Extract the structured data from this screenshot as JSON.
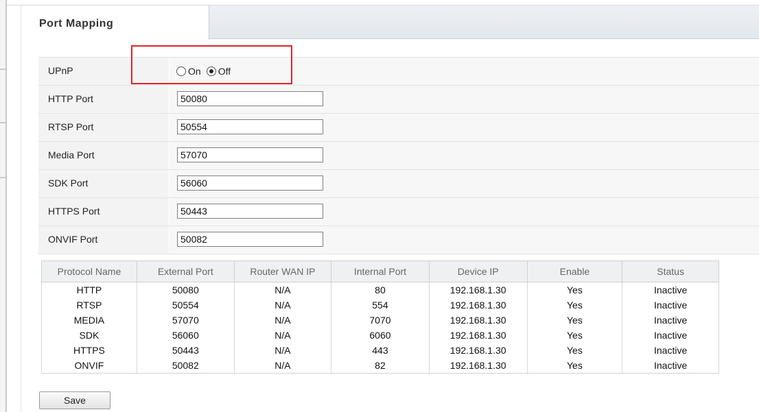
{
  "tab": {
    "title": "Port Mapping"
  },
  "upnp": {
    "label": "UPnP",
    "options": [
      {
        "label": "On",
        "checked": false
      },
      {
        "label": "Off",
        "checked": true
      }
    ]
  },
  "ports": [
    {
      "label": "HTTP Port",
      "value": "50080"
    },
    {
      "label": "RTSP Port",
      "value": "50554"
    },
    {
      "label": "Media Port",
      "value": "57070"
    },
    {
      "label": "SDK Port",
      "value": "56060"
    },
    {
      "label": "HTTPS Port",
      "value": "50443"
    },
    {
      "label": "ONVIF Port",
      "value": "50082"
    }
  ],
  "mapping_table": {
    "columns": [
      "Protocol Name",
      "External Port",
      "Router WAN IP",
      "Internal Port",
      "Device IP",
      "Enable",
      "Status"
    ],
    "rows": [
      [
        "HTTP",
        "50080",
        "N/A",
        "80",
        "192.168.1.30",
        "Yes",
        "Inactive"
      ],
      [
        "RTSP",
        "50554",
        "N/A",
        "554",
        "192.168.1.30",
        "Yes",
        "Inactive"
      ],
      [
        "MEDIA",
        "57070",
        "N/A",
        "7070",
        "192.168.1.30",
        "Yes",
        "Inactive"
      ],
      [
        "SDK",
        "56060",
        "N/A",
        "6060",
        "192.168.1.30",
        "Yes",
        "Inactive"
      ],
      [
        "HTTPS",
        "50443",
        "N/A",
        "443",
        "192.168.1.30",
        "Yes",
        "Inactive"
      ],
      [
        "ONVIF",
        "50082",
        "N/A",
        "82",
        "192.168.1.30",
        "Yes",
        "Inactive"
      ]
    ]
  },
  "save_label": "Save",
  "colors": {
    "highlight": "#e0242b",
    "label_bg": "#f3f3f3",
    "header_bg": "#eef0f2"
  }
}
